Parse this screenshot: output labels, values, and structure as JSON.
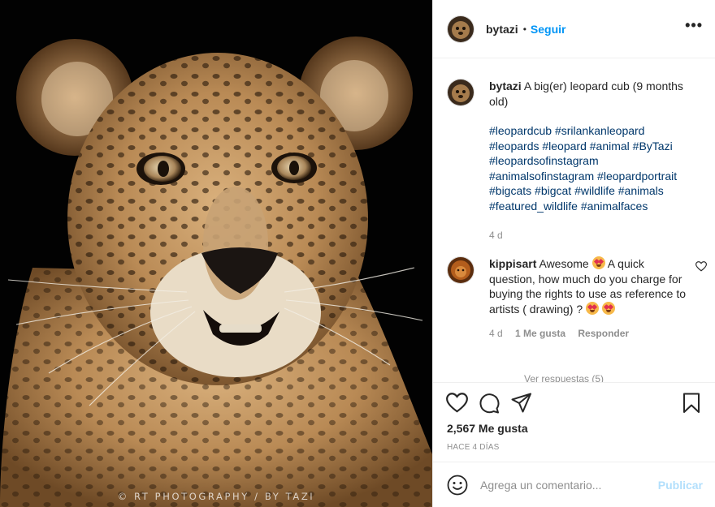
{
  "photo": {
    "watermark": "© RT PHOTOGRAPHY  / BY TAZI",
    "subject_icon": "leopard-portrait"
  },
  "header": {
    "username": "bytazi",
    "separator": "•",
    "follow_label": "Seguir",
    "more_icon": "more-horizontal-icon"
  },
  "caption": {
    "username": "bytazi",
    "text": "A big(er) leopard cub (9 months old)",
    "hashtags": "#leopardcub #srilankanleopard #leopards #leopard #animal #ByTazi #leopardsofinstagram #animalsofinstagram #leopardportrait #bigcats #bigcat #wildlife #animals #featured_wildlife #animalfaces",
    "time": "4 d"
  },
  "comment": {
    "username": "kippisart",
    "text_1": "Awesome",
    "text_2": "A quick question, how much do you charge for buying the rights to use as reference to artists ( drawing) ?",
    "emoji": "heart-eyes-emoji",
    "time": "4 d",
    "likes": "1 Me gusta",
    "reply_label": "Responder",
    "view_replies": "Ver respuestas (5)"
  },
  "actions": {
    "likes": "2,567 Me gusta",
    "ago": "HACE 4 DÍAS"
  },
  "comment_box": {
    "placeholder": "Agrega un comentario...",
    "publish_label": "Publicar"
  },
  "colors": {
    "link_blue": "#0095f6",
    "hashtag_blue": "#00376b",
    "muted": "#8e8e8e",
    "publish_disabled": "#b2dffc"
  }
}
